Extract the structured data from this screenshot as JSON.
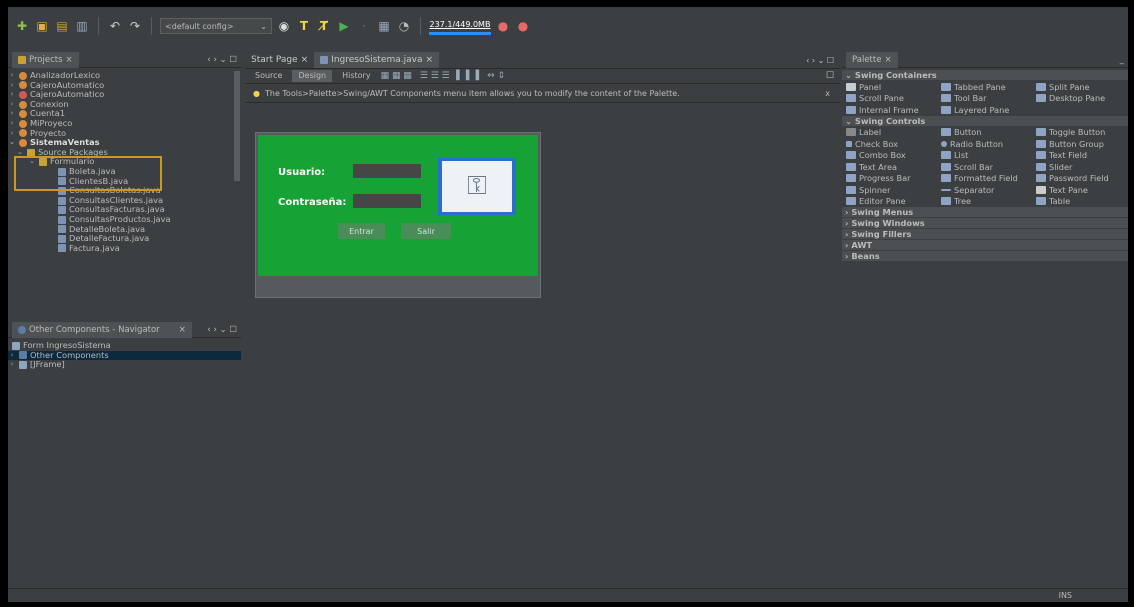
{
  "toolbar": {
    "config": "<default config>",
    "memory": "237.1/449.0MB"
  },
  "projects": {
    "title": "Projects",
    "items": [
      {
        "label": "AnalizadorLexico"
      },
      {
        "label": "CajeroAutomatico"
      },
      {
        "label": "CajeroAutomatico"
      },
      {
        "label": "Conexion"
      },
      {
        "label": "Cuenta1"
      },
      {
        "label": "MiProyeco"
      },
      {
        "label": "Proyecto"
      },
      {
        "label": "SistemaVentas"
      },
      {
        "label": "Source Packages"
      },
      {
        "label": "Formulario"
      },
      {
        "label": "Boleta.java"
      },
      {
        "label": "ClientesB.java"
      },
      {
        "label": "ConsultasBoletas.java"
      },
      {
        "label": "ConsultasClientes.java"
      },
      {
        "label": "ConsultasFacturas.java"
      },
      {
        "label": "ConsultasProductos.java"
      },
      {
        "label": "DetalleBoleta.java"
      },
      {
        "label": "DetalleFactura.java"
      },
      {
        "label": "Factura.java"
      }
    ]
  },
  "navigator": {
    "title": "Other Components - Navigator",
    "items": [
      {
        "label": "Form IngresoSistema"
      },
      {
        "label": "Other Components"
      },
      {
        "label": "[JFrame]"
      }
    ]
  },
  "editor": {
    "tabs": [
      "Start Page",
      "IngresoSistema.java"
    ],
    "subtabs": [
      "Source",
      "Design",
      "History"
    ],
    "tip": "The Tools>Palette>Swing/AWT Components menu item allows you to modify the content of the Palette.",
    "close": "x"
  },
  "form": {
    "user_label": "Usuario:",
    "pass_label": "Contraseña:",
    "enter": "Entrar",
    "exit": "Salir"
  },
  "palette": {
    "title": "Palette",
    "containers_title": "Swing Containers",
    "containers": [
      "Panel",
      "Tabbed Pane",
      "Split Pane",
      "Scroll Pane",
      "Tool Bar",
      "Desktop Pane",
      "Internal Frame",
      "Layered Pane"
    ],
    "controls_title": "Swing Controls",
    "controls": [
      "Label",
      "Button",
      "Toggle Button",
      "Check Box",
      "Radio Button",
      "Button Group",
      "Combo Box",
      "List",
      "Text Field",
      "Text Area",
      "Scroll Bar",
      "Slider",
      "Progress Bar",
      "Formatted Field",
      "Password Field",
      "Spinner",
      "Separator",
      "Text Pane",
      "Editor Pane",
      "Tree",
      "Table"
    ],
    "categories": [
      "Swing Menus",
      "Swing Windows",
      "Swing Fillers",
      "AWT",
      "Beans"
    ]
  },
  "status": {
    "mode": "INS"
  }
}
